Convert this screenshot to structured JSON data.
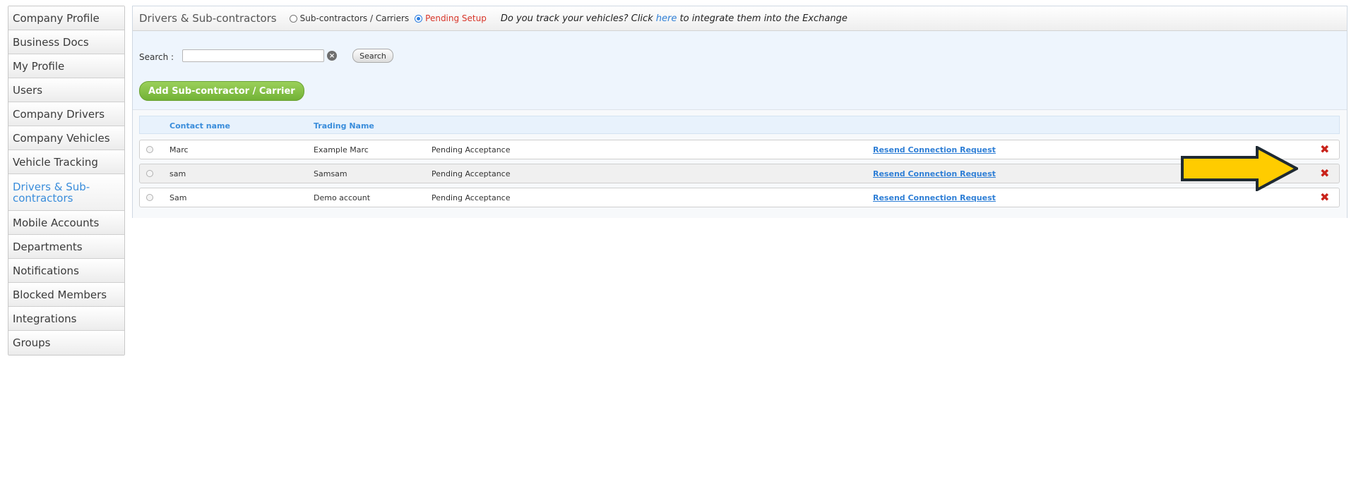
{
  "sidebar": {
    "items": [
      {
        "label": "Company Profile"
      },
      {
        "label": "Business Docs"
      },
      {
        "label": "My Profile"
      },
      {
        "label": "Users"
      },
      {
        "label": "Company Drivers"
      },
      {
        "label": "Company Vehicles"
      },
      {
        "label": "Vehicle Tracking"
      },
      {
        "label": "Drivers & Sub-contractors"
      },
      {
        "label": "Mobile Accounts"
      },
      {
        "label": "Departments"
      },
      {
        "label": "Notifications"
      },
      {
        "label": "Blocked Members"
      },
      {
        "label": "Integrations"
      },
      {
        "label": "Groups"
      }
    ]
  },
  "header": {
    "title": "Drivers & Sub-contractors",
    "radio_carriers": "Sub-contractors / Carriers",
    "radio_pending": "Pending Setup",
    "notice_before": "Do you track your vehicles? Click",
    "notice_link": "here",
    "notice_after": "to integrate them into the Exchange"
  },
  "search": {
    "label": "Search :",
    "value": "",
    "clear_icon": "×",
    "button": "Search"
  },
  "add_button": "Add Sub-contractor / Carrier",
  "columns": {
    "contact": "Contact name",
    "trading": "Trading Name"
  },
  "rows": [
    {
      "contact": "Marc",
      "trading": "Example Marc",
      "status": "Pending Acceptance",
      "action": "Resend Connection Request"
    },
    {
      "contact": "sam",
      "trading": "Samsam",
      "status": "Pending Acceptance",
      "action": "Resend Connection Request"
    },
    {
      "contact": "Sam",
      "trading": "Demo account",
      "status": "Pending Acceptance",
      "action": "Resend Connection Request"
    }
  ],
  "delete_glyph": "✖",
  "colors": {
    "accent": "#3a8ddb",
    "pending": "#d8362a",
    "add_button": "#7dbb3e",
    "delete": "#c9231b",
    "arrow_fill": "#ffcc00",
    "arrow_stroke": "#1f2a33"
  }
}
